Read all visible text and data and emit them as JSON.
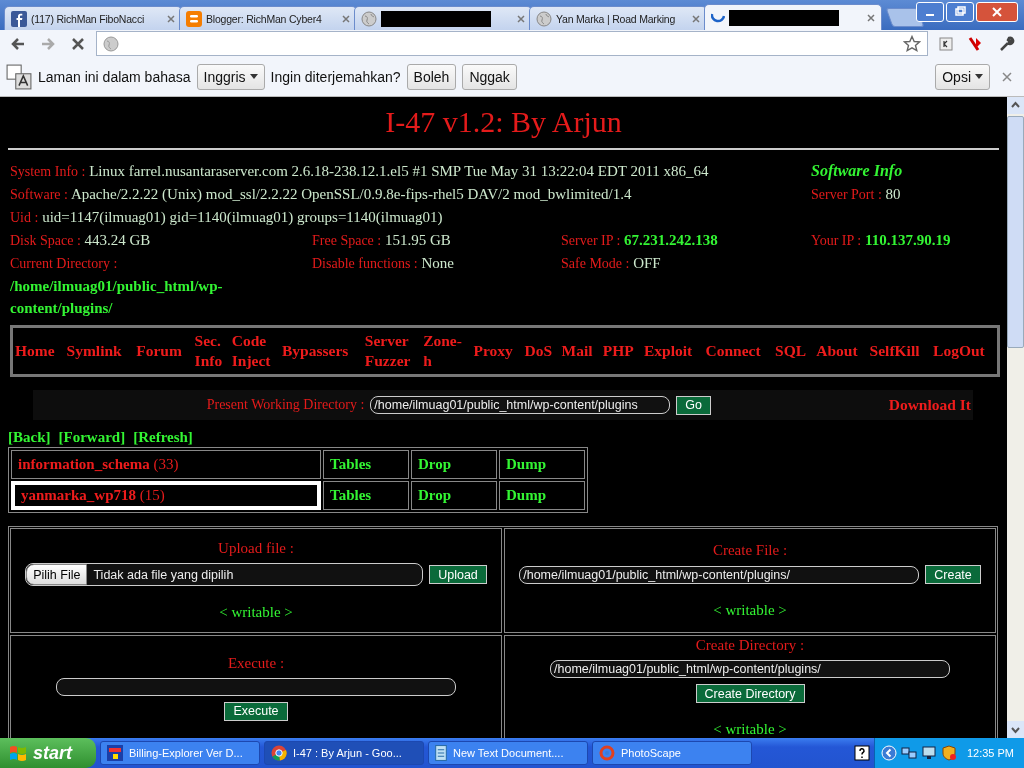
{
  "browser": {
    "tabs": [
      {
        "title": "(117) RichMan FiboNacci",
        "redacted": false,
        "selected": false
      },
      {
        "title": "Blogger: RichMan Cyber4",
        "redacted": false,
        "selected": false
      },
      {
        "redacted": true,
        "selected": false
      },
      {
        "title": "Yan Marka | Road Marking",
        "redacted": false,
        "selected": false
      },
      {
        "redacted": true,
        "selected": true
      }
    ],
    "translate_bar": {
      "text": "Laman ini dalam bahasa",
      "language": "Inggris",
      "question": "Ingin diterjemahkan?",
      "buttons": [
        "Boleh",
        "Nggak"
      ],
      "options": "Opsi"
    }
  },
  "page": {
    "title": "I-47 v1.2: By Arjun",
    "info": [
      [
        {
          "label": "System Info :",
          "value": "Linux farrel.nusantaraserver.com 2.6.18-238.12.1.el5 #1 SMP Tue May 31 13:22:04 EDT 2011 x86_64",
          "kind": "plain"
        },
        {
          "value": "Software Info",
          "kind": "heading"
        }
      ],
      [
        {
          "label": "Software :",
          "value": "Apache/2.2.22 (Unix) mod_ssl/2.2.22 OpenSSL/0.9.8e-fips-rhel5 DAV/2 mod_bwlimited/1.4",
          "kind": "plain"
        },
        {
          "label": "Server Port :",
          "value": "80",
          "kind": "plain"
        }
      ],
      [
        {
          "label": "Uid :",
          "value": "uid=1147(ilmuag01) gid=1140(ilmuag01) groups=1140(ilmuag01)",
          "kind": "plain"
        }
      ],
      [
        {
          "label": "Disk Space :",
          "value": "443.24 GB",
          "kind": "plain"
        },
        {
          "label": "Free Space :",
          "value": "151.95 GB",
          "kind": "plain"
        },
        {
          "label": "Server IP :",
          "value": "67.231.242.138",
          "kind": "strong"
        },
        {
          "label": "Your IP :",
          "value": "110.137.90.19",
          "kind": "strong"
        }
      ],
      [
        {
          "label": "Current Directory :",
          "value": "/home/ilmuag01/public_html/wp-content/plugins/",
          "kind": "strong"
        },
        {
          "label": "Disable functions :",
          "value": "None",
          "kind": "plain"
        },
        {
          "label": "Safe Mode :",
          "value": "OFF",
          "kind": "plain"
        }
      ]
    ],
    "nav": [
      "Home",
      "Symlink",
      "Forum",
      "Sec. Info",
      "Code Inject",
      "Bypassers",
      "Server Fuzzer",
      "Zone-h",
      "Proxy",
      "DoS",
      "Mail",
      "PHP",
      "Exploit",
      "Connect",
      "SQL",
      "About",
      "SelfKill",
      "LogOut"
    ],
    "pwd": {
      "label": "Present Working Directory :",
      "value": "/home/ilmuag01/public_html/wp-content/plugins",
      "button": "Go",
      "download": "Download It"
    },
    "history": [
      "[Back]",
      "[Forward]",
      "[Refresh]"
    ],
    "databases": [
      {
        "name": "information_schema",
        "count": "(33)",
        "actions": [
          "Tables",
          "Drop",
          "Dump"
        ],
        "selected": false
      },
      {
        "name": "yanmarka_wp718",
        "count": "(15)",
        "actions": [
          "Tables",
          "Drop",
          "Dump"
        ],
        "selected": true
      }
    ],
    "tools": [
      {
        "kind": "upload",
        "title": "Upload file :",
        "choose": "Pilih File",
        "file": "Tidak ada file yang dipilih",
        "button": "Upload",
        "status": "< writable >"
      },
      {
        "kind": "inline-input",
        "title": "Create File :",
        "value": "/home/ilmuag01/public_html/wp-content/plugins/",
        "button": "Create",
        "status": "< writable >"
      },
      {
        "kind": "stacked-input",
        "title": "Execute :",
        "button": "Execute"
      },
      {
        "kind": "stacked-input",
        "title": "Create Directory :",
        "value": "/home/ilmuag01/public_html/wp-content/plugins/",
        "button": "Create Directory",
        "status": "< writable >"
      }
    ]
  },
  "taskbar": {
    "start": "start",
    "tasks": [
      {
        "title": "Billing-Explorer Ver D...",
        "selected": false
      },
      {
        "title": "I-47 : By Arjun - Goo...",
        "selected": true
      },
      {
        "title": "New Text Document....",
        "selected": false
      },
      {
        "title": "PhotoScape",
        "selected": false
      }
    ],
    "time": "12:35 PM"
  }
}
